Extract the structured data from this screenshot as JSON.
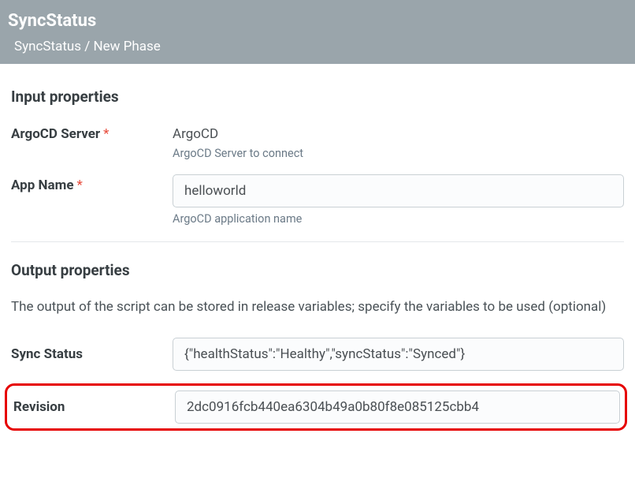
{
  "header": {
    "title": "SyncStatus",
    "breadcrumb": "SyncStatus / New Phase"
  },
  "input_section": {
    "title": "Input properties",
    "server": {
      "label": "ArgoCD Server",
      "value": "ArgoCD",
      "help": "ArgoCD Server to connect"
    },
    "app_name": {
      "label": "App Name",
      "value": "helloworld",
      "help": "ArgoCD application name"
    }
  },
  "output_section": {
    "title": "Output properties",
    "description": "The output of the script can be stored in release variables; specify the variables to be used (optional)",
    "sync_status": {
      "label": "Sync Status",
      "value": "{\"healthStatus\":\"Healthy\",\"syncStatus\":\"Synced\"}"
    },
    "revision": {
      "label": "Revision",
      "value": "2dc0916fcb440ea6304b49a0b80f8e085125cbb4"
    }
  }
}
